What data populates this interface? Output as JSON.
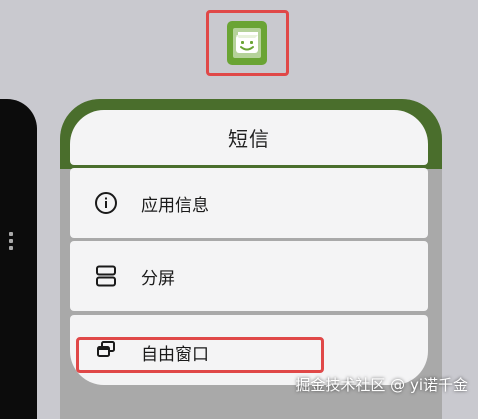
{
  "app": {
    "title": "短信",
    "icon": "sms-app-icon",
    "accent": "#6aa434",
    "band_color": "#4a6e2c"
  },
  "menu": {
    "items": [
      {
        "label": "应用信息",
        "icon": "info-icon"
      },
      {
        "label": "分屏",
        "icon": "split-screen-icon"
      },
      {
        "label": "自由窗口",
        "icon": "free-window-icon"
      }
    ]
  },
  "highlight_color": "#e04848",
  "watermark": "掘金技术社区 @ yi诺千金"
}
